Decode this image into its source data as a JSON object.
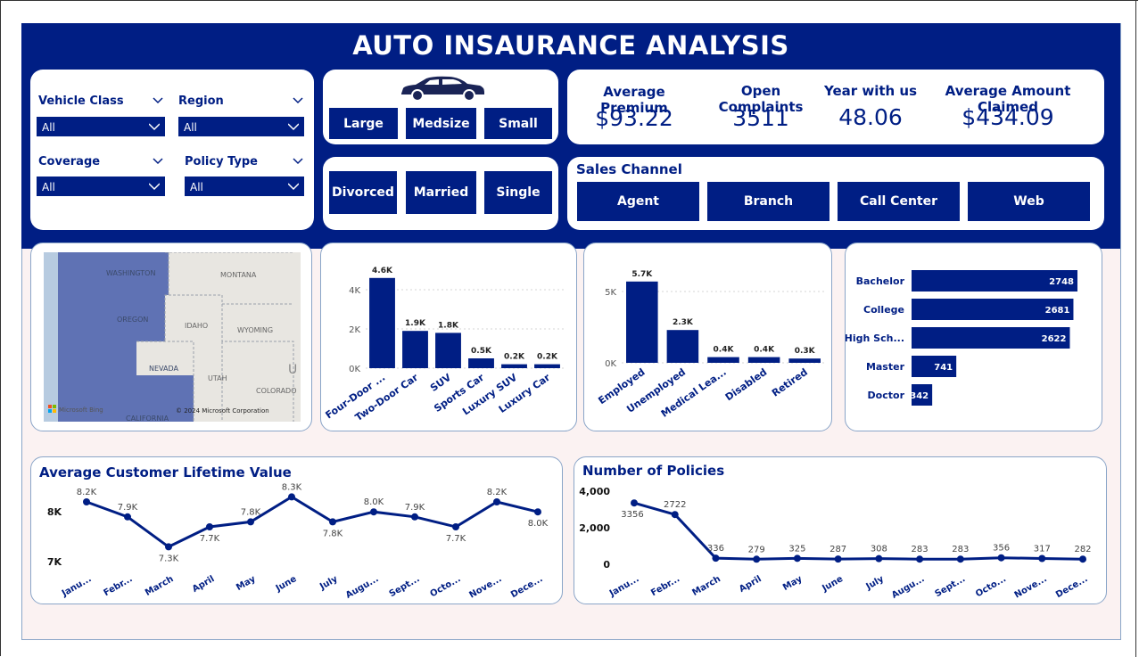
{
  "title": "AUTO INSAURANCE ANALYSIS",
  "colors": {
    "navy": "#001e84",
    "map_region": "#5f72b4",
    "canvas": "#fbf2f2"
  },
  "filters": [
    {
      "label": "Vehicle Class",
      "value": "All"
    },
    {
      "label": "Region",
      "value": "All"
    },
    {
      "label": "Coverage",
      "value": "All"
    },
    {
      "label": "Policy Type",
      "value": "All"
    }
  ],
  "vehicle_size": {
    "icon": "car-icon",
    "buttons": [
      "Large",
      "Medsize",
      "Small"
    ]
  },
  "marital": {
    "buttons": [
      "Divorced",
      "Married",
      "Single"
    ]
  },
  "kpis": [
    {
      "label": "Average Premium",
      "value": "$93.22"
    },
    {
      "label": "Open Complaints",
      "value": "3511"
    },
    {
      "label": "Year with us",
      "value": "48.06"
    },
    {
      "label": "Average Amount Claimed",
      "value": "$434.09"
    }
  ],
  "sales_channel": {
    "title": "Sales Channel",
    "buttons": [
      "Agent",
      "Branch",
      "Call Center",
      "Web"
    ]
  },
  "map": {
    "labels": [
      "WASHINGTON",
      "MONTANA",
      "OREGON",
      "IDAHO",
      "WYOMING",
      "NEVADA",
      "UTAH",
      "COLORADO",
      "CALIFORNIA",
      "U"
    ],
    "brand": "Microsoft Bing",
    "copyright": "© 2024 Microsoft Corporation"
  },
  "chart_data": [
    {
      "type": "bar",
      "id": "vehicle_class",
      "categories": [
        "Four-Door ...",
        "Two-Door Car",
        "SUV",
        "Sports Car",
        "Luxury SUV",
        "Luxury Car"
      ],
      "values": [
        4600,
        1900,
        1800,
        500,
        200,
        200
      ],
      "data_labels": [
        "4.6K",
        "1.9K",
        "1.8K",
        "0.5K",
        "0.2K",
        "0.2K"
      ],
      "yticks": [
        "0K",
        "2K",
        "4K"
      ],
      "ylim": [
        0,
        5000
      ],
      "grid": true
    },
    {
      "type": "bar",
      "id": "employment_status",
      "categories": [
        "Employed",
        "Unemployed",
        "Medical Lea...",
        "Disabled",
        "Retired"
      ],
      "values": [
        5700,
        2300,
        400,
        400,
        300
      ],
      "data_labels": [
        "5.7K",
        "2.3K",
        "0.4K",
        "0.4K",
        "0.3K"
      ],
      "yticks": [
        "0K",
        "5K"
      ],
      "ylim": [
        0,
        6000
      ],
      "grid": true
    },
    {
      "type": "bar",
      "orientation": "horizontal",
      "id": "education",
      "categories": [
        "Bachelor",
        "College",
        "High Sch...",
        "Master",
        "Doctor"
      ],
      "values": [
        2748,
        2681,
        2622,
        741,
        342
      ],
      "data_labels": [
        "2748",
        "2681",
        "2622",
        "741",
        "342"
      ]
    },
    {
      "type": "line",
      "id": "avg_clv",
      "title": "Average Customer Lifetime Value",
      "categories": [
        "Janu...",
        "Febr...",
        "March",
        "April",
        "May",
        "June",
        "July",
        "Augu...",
        "Sept...",
        "Octo...",
        "Nove...",
        "Dece..."
      ],
      "values": [
        8200,
        7900,
        7300,
        7700,
        7800,
        8300,
        7800,
        8000,
        7900,
        7700,
        8200,
        8000
      ],
      "data_labels": [
        "8.2K",
        "7.9K",
        "7.3K",
        "7.7K",
        "7.8K",
        "8.3K",
        "7.8K",
        "8.0K",
        "7.9K",
        "7.7K",
        "8.2K",
        "8.0K"
      ],
      "yticks": [
        "7K",
        "8K"
      ],
      "ylim": [
        6950,
        8450
      ]
    },
    {
      "type": "line",
      "id": "num_policies",
      "title": "Number of Policies",
      "categories": [
        "Janu...",
        "Febr...",
        "March",
        "April",
        "May",
        "June",
        "July",
        "Augu...",
        "Sept...",
        "Octo...",
        "Nove...",
        "Dece..."
      ],
      "values": [
        3356,
        2722,
        336,
        279,
        325,
        287,
        308,
        283,
        283,
        356,
        317,
        282
      ],
      "data_labels": [
        "3356",
        "2722",
        "336",
        "279",
        "325",
        "287",
        "308",
        "283",
        "283",
        "356",
        "317",
        "282"
      ],
      "yticks": [
        "0",
        "2,000",
        "4,000"
      ],
      "ylim": [
        0,
        4000
      ]
    }
  ]
}
